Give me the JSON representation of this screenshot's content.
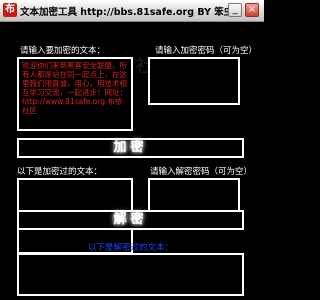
{
  "window": {
    "title": "文本加密工具 http://bbs.81safe.org  BY 笨虫",
    "icon_char": "布",
    "minimize_label": "_",
    "close_label": "×"
  },
  "encrypt": {
    "input_label": "请输入要加密的文本：",
    "password_label": "请输入加密密码（可为空）",
    "input_value": "欢迎你们来到黑客安全联盟，所有人都是站在同一起点上，在这里我们用真诚，用心，用技术相互学习交流，一起进步！网址：http://www.81safe.org 布依社区",
    "password_value": "",
    "button_label": "加密"
  },
  "decrypt": {
    "input_label": "以下是加密过的文本：",
    "password_label": "请输入解密密码（可为空）",
    "input_value": "",
    "password_value": "",
    "button_label": "解密"
  },
  "output": {
    "label": "以下是解密过的文本：",
    "value": ""
  },
  "watermark": "布依社区",
  "colors": {
    "background": "#000000",
    "border": "#ffffff",
    "plain_text": "#e02020",
    "output_label": "#2040ff"
  }
}
